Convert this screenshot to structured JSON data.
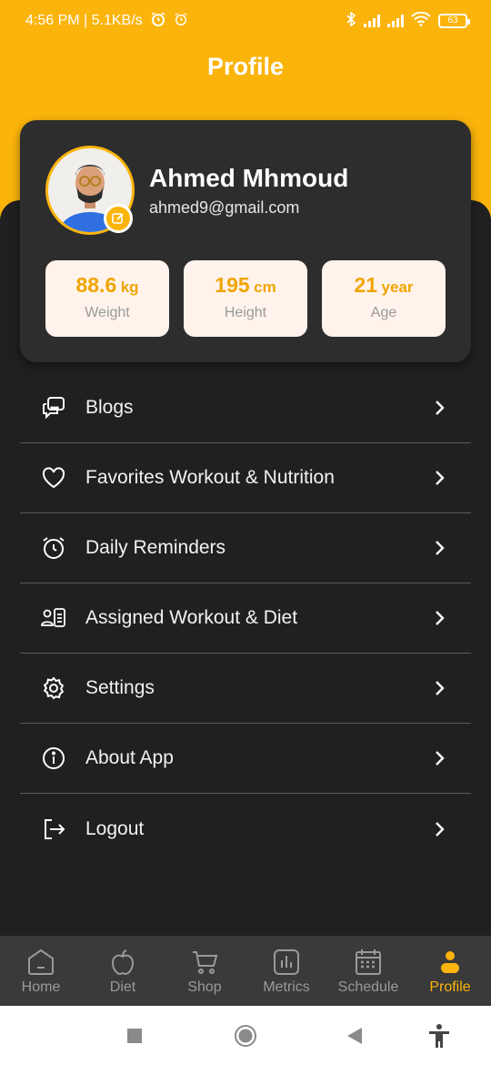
{
  "status_bar": {
    "time_net": "4:56 PM | 5.1KB/s",
    "battery": "63",
    "icons": [
      "alarm-icon",
      "alarm-icon",
      "bluetooth-icon",
      "signal-icon",
      "signal-icon",
      "wifi-icon",
      "battery-icon"
    ]
  },
  "header": {
    "title": "Profile"
  },
  "profile": {
    "name": "Ahmed Mhmoud",
    "email": "ahmed9@gmail.com",
    "stats": [
      {
        "value": "88.6",
        "unit": "kg",
        "label": "Weight"
      },
      {
        "value": "195",
        "unit": "cm",
        "label": "Height"
      },
      {
        "value": "21",
        "unit": "year",
        "label": "Age"
      }
    ]
  },
  "menu": [
    {
      "label": "Blogs",
      "icon": "chat-bubbles-icon"
    },
    {
      "label": "Favorites Workout & Nutrition",
      "icon": "heart-icon"
    },
    {
      "label": "Daily Reminders",
      "icon": "alarm-clock-icon"
    },
    {
      "label": "Assigned Workout & Diet",
      "icon": "user-list-icon"
    },
    {
      "label": "Settings",
      "icon": "gear-icon"
    },
    {
      "label": "About App",
      "icon": "info-icon"
    },
    {
      "label": "Logout",
      "icon": "logout-icon"
    }
  ],
  "bottom_nav": [
    {
      "label": "Home",
      "icon": "home-icon",
      "active": false
    },
    {
      "label": "Diet",
      "icon": "apple-icon",
      "active": false
    },
    {
      "label": "Shop",
      "icon": "cart-icon",
      "active": false
    },
    {
      "label": "Metrics",
      "icon": "bar-chart-icon",
      "active": false
    },
    {
      "label": "Schedule",
      "icon": "calendar-icon",
      "active": false
    },
    {
      "label": "Profile",
      "icon": "person-icon",
      "active": true
    }
  ],
  "colors": {
    "accent": "#fbb40b",
    "background": "#202020",
    "card": "#2d2d2d",
    "stat_bg": "#fff3ec",
    "nav_bg": "#3a3a3a"
  }
}
